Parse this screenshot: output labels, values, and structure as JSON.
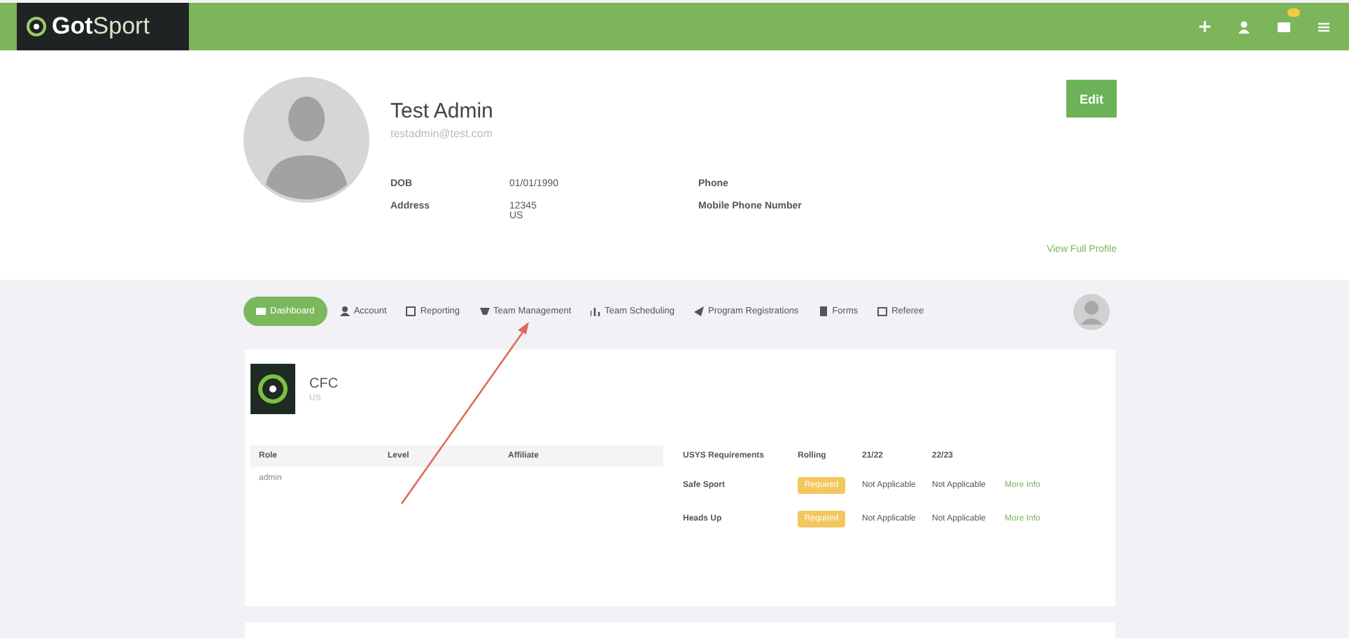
{
  "header": {
    "logo": "**Got**Sport"
  },
  "profile": {
    "name": "Test Admin",
    "email": "testadmin@test.com",
    "edit": "Edit",
    "fields": [
      {
        "label": "DOB",
        "value": [
          "01/01/1990"
        ]
      },
      {
        "label": "Phone"
      },
      {
        "label": "Address",
        "value": [
          "12345",
          "US"
        ]
      },
      {
        "label": "Mobile Phone Number"
      }
    ],
    "link": "View Full Profile"
  },
  "nav": [
    {
      "label": "Dashboard",
      "selected": true
    },
    {
      "label": "Account",
      "selected": false
    },
    {
      "label": "Reporting",
      "selected": false
    },
    {
      "label": "Team Management",
      "selected": false
    },
    {
      "label": "Team Scheduling",
      "selected": false
    },
    {
      "label": "Program Registrations",
      "selected": false
    },
    {
      "label": "Forms",
      "selected": false
    },
    {
      "label": "Referee",
      "selected": false
    }
  ],
  "club": {
    "name": "CFC",
    "sub": "US",
    "roles": {
      "columns": [
        "Role",
        "Level",
        "Affiliate"
      ],
      "rows": [
        [
          "admin",
          "",
          ""
        ]
      ]
    },
    "requirements": {
      "columns": [
        "USYS Requirements",
        "Rolling",
        "21/22",
        "22/23"
      ],
      "rows": [
        {
          "name": "Safe Sport",
          "status": "Required",
          "c1": "Not Applicable",
          "c2": "Not Applicable",
          "link": "More Info"
        },
        {
          "name": "Heads Up",
          "status": "Required",
          "c1": "Not Applicable",
          "c2": "Not Applicable",
          "link": "More Info"
        }
      ]
    }
  }
}
